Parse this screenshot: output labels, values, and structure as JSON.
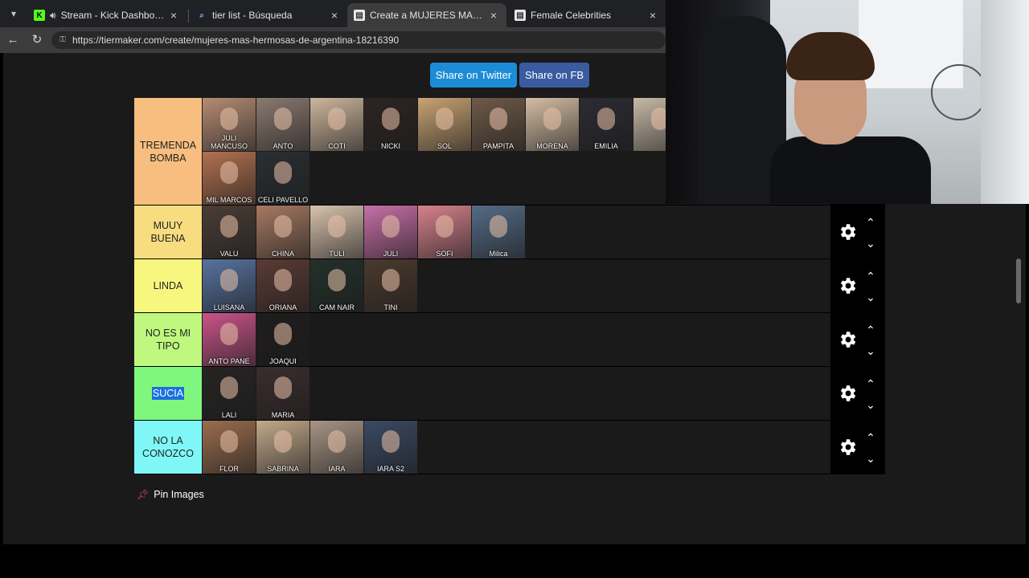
{
  "browser": {
    "tabs": [
      {
        "title": "Stream - Kick Dashboard",
        "favicon": "kick-logo",
        "active": false,
        "audio": true
      },
      {
        "title": "tier list - Búsqueda",
        "favicon": "search",
        "active": false,
        "audio": false
      },
      {
        "title": "Create a MUJERES MAS HERMOSAS",
        "favicon": "tiermaker",
        "active": true,
        "audio": false
      },
      {
        "title": "Female Celebrities",
        "favicon": "tiermaker",
        "active": false,
        "audio": false
      }
    ],
    "url": "https://tiermaker.com/create/mujeres-mas-hermosas-de-argentina-18216390"
  },
  "share": {
    "twitter_label": "Share on Twitter",
    "facebook_label": "Share on FB"
  },
  "tiers": [
    {
      "label": "TREMENDA BOMBA",
      "color": "#f7be7f",
      "items": [
        {
          "caption": "JULI MANCUSO",
          "color": "#b58c74"
        },
        {
          "caption": "ANTO",
          "color": "#8a7a70"
        },
        {
          "caption": "COTI",
          "color": "#cdb69d"
        },
        {
          "caption": "NICKI",
          "color": "#2c2423"
        },
        {
          "caption": "SOL",
          "color": "#c9a373"
        },
        {
          "caption": "PAMPITA",
          "color": "#6e5a4a"
        },
        {
          "caption": "MORENA",
          "color": "#d4bda4"
        },
        {
          "caption": "EMILIA",
          "color": "#2b2b33"
        },
        {
          "caption": "",
          "color": "#c7b9a6"
        },
        {
          "caption": "MIL MARCOS",
          "color": "#b27150"
        },
        {
          "caption": "CELI PAVELLO",
          "color": "#2a2f33"
        }
      ]
    },
    {
      "label": "MUUY BUENA",
      "color": "#f7dd7f",
      "items": [
        {
          "caption": "VALU",
          "color": "#4a3d36"
        },
        {
          "caption": "CHINA",
          "color": "#a67a62"
        },
        {
          "caption": "TULI",
          "color": "#d8c3ae"
        },
        {
          "caption": "JULI",
          "color": "#c770a8"
        },
        {
          "caption": "SOFI",
          "color": "#d6828c"
        },
        {
          "caption": "Milica",
          "color": "#546b86"
        }
      ]
    },
    {
      "label": "LINDA",
      "color": "#f7f77f",
      "items": [
        {
          "caption": "LUISANA",
          "color": "#5873a0"
        },
        {
          "caption": "ORIANA",
          "color": "#5a3b35"
        },
        {
          "caption": "CAM NAIR",
          "color": "#23302a"
        },
        {
          "caption": "TINI",
          "color": "#4a3a2e"
        }
      ]
    },
    {
      "label": "NO ES MI TIPO",
      "color": "#bff77f",
      "items": [
        {
          "caption": "ANTO PANE",
          "color": "#c9548a"
        },
        {
          "caption": "JOAQUI",
          "color": "#1f1d1d"
        }
      ]
    },
    {
      "label": "SUCIA",
      "color": "#7ff77f",
      "items": [
        {
          "caption": "LALI",
          "color": "#262423"
        },
        {
          "caption": "MARIA",
          "color": "#3a2d2e"
        }
      ]
    },
    {
      "label": "NO LA CONOZCO",
      "color": "#7ff7f7",
      "items": [
        {
          "caption": "FLOR",
          "color": "#9a6d4f"
        },
        {
          "caption": "SABRINA",
          "color": "#c3a98a"
        },
        {
          "caption": "IARA",
          "color": "#a89585"
        },
        {
          "caption": "IARA S2",
          "color": "#3a4a62"
        }
      ]
    }
  ],
  "pin": {
    "label": "Pin Images",
    "icon": "pushpin-icon"
  },
  "colors": {
    "twitter": "#1d8cd6",
    "facebook": "#3a5ba0",
    "page_bg": "#1a1a1a"
  }
}
